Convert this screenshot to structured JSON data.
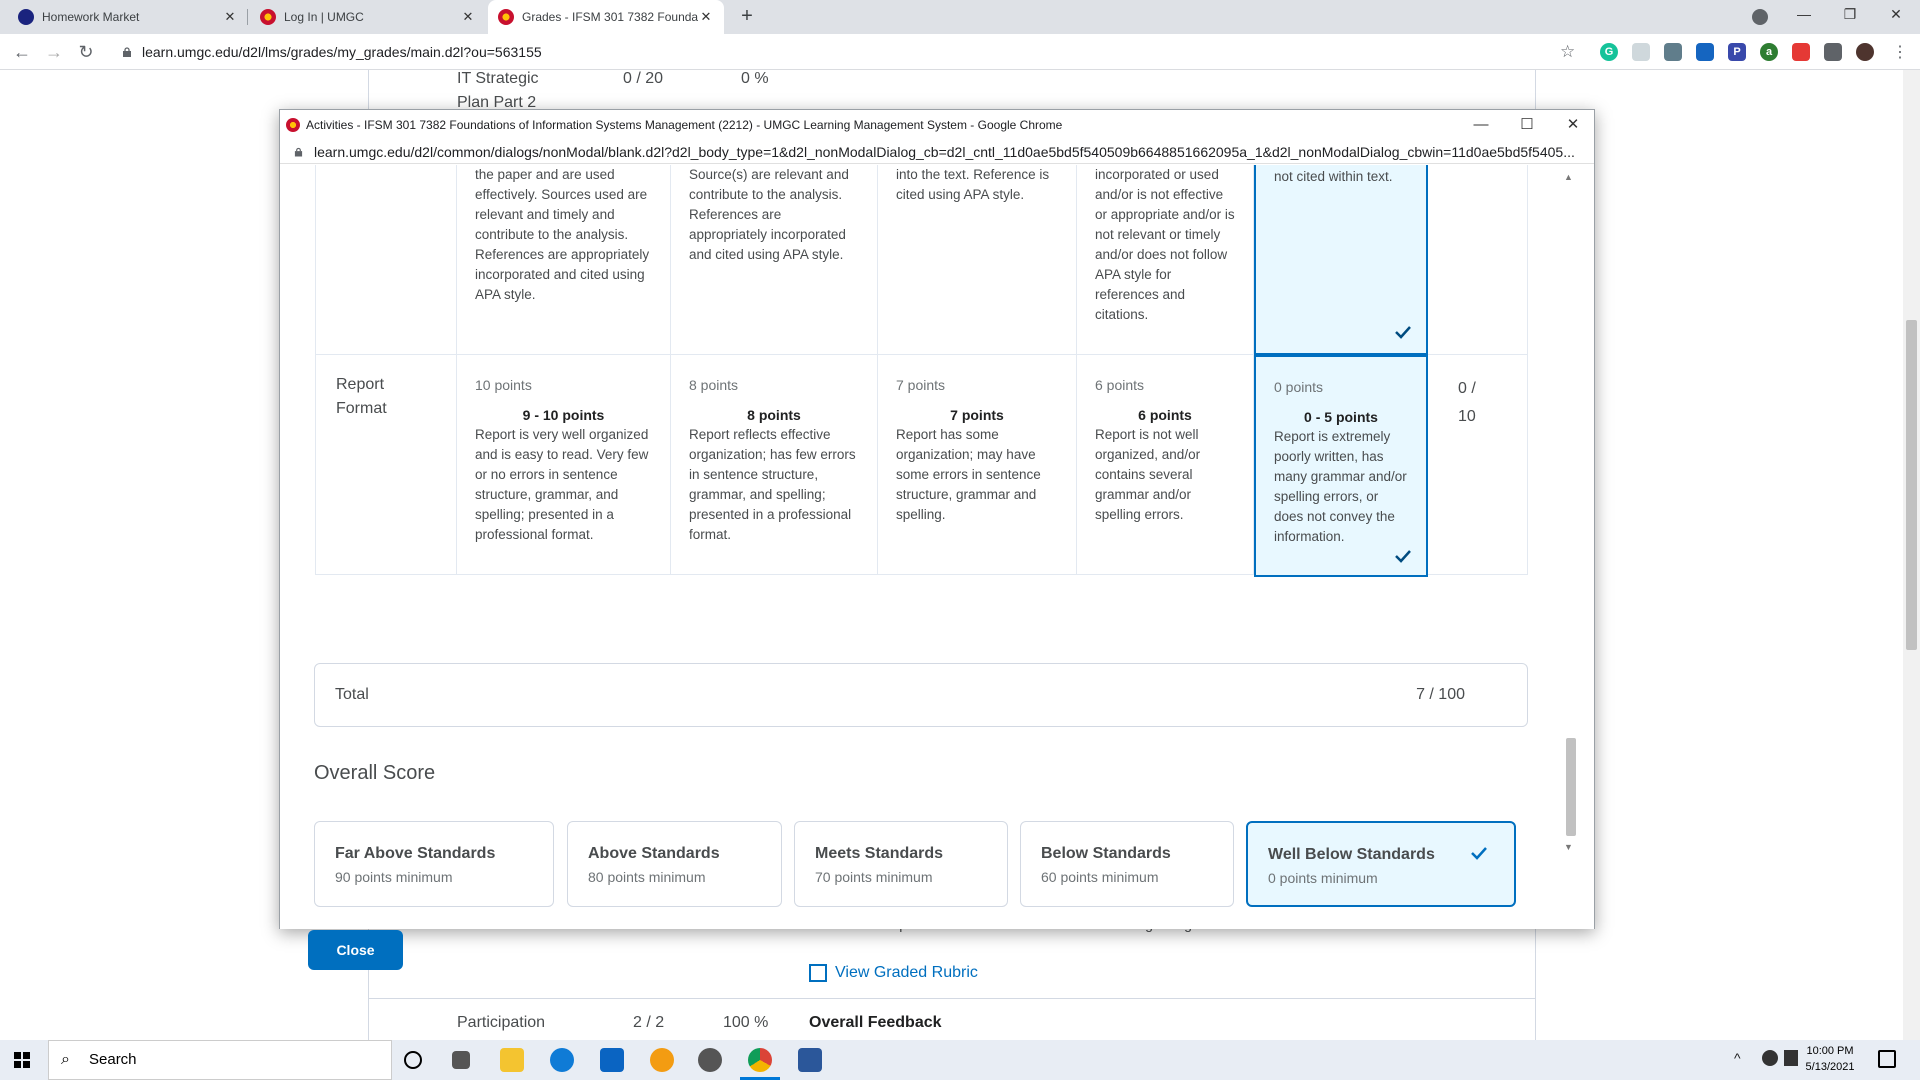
{
  "browser": {
    "tabs": [
      {
        "title": "Homework Market"
      },
      {
        "title": "Log In | UMGC"
      },
      {
        "title": "Grades - IFSM 301 7382 Foundat"
      }
    ],
    "url": "learn.umgc.edu/d2l/lms/grades/my_grades/main.d2l?ou=563155"
  },
  "background_page": {
    "row1": {
      "name": "IT Strategic",
      "name2": "Plan Part 2",
      "score": "0 / 20",
      "pct": "0 %"
    },
    "partial_text": "to at least two posts to meet or exceed the discussion grading standard.",
    "view_rubric": "View Graded Rubric",
    "row2": {
      "name": "Participation",
      "score": "2 / 2",
      "pct": "100 %",
      "feedback": "Overall Feedback"
    }
  },
  "popup": {
    "window_title": "Activities - IFSM 301 7382 Foundations of Information Systems Management (2212) - UMGC Learning Management System - Google Chrome",
    "url": "learn.umgc.edu/d2l/common/dialogs/nonModal/blank.d2l?d2l_body_type=1&d2l_nonModalDialog_cb=d2l_cntl_11d0ae5bd5f540509b6648851662095a_1&d2l_nonModalDialog_cbwin=11d0ae5bd5f5405...",
    "top_row": [
      "the paper and are used effectively. Sources used are relevant and timely and contribute to the analysis. References are appropriately incorporated and cited using APA style.",
      "Source(s) are relevant and contribute to the analysis. References are appropriately incorporated and cited using APA style.",
      "into the text. Reference is cited using APA style.",
      "incorporated or used and/or is not effective or appropriate and/or is not relevant or timely and/or does not follow APA style for references and citations.",
      "not cited within text."
    ],
    "report_format": {
      "criterion": "Report Format",
      "score_num": "0 /",
      "score_den": "10",
      "levels": [
        {
          "points": "10 points",
          "range": "9 - 10 points",
          "desc": "Report is very well organized and is easy to read.  Very few or no errors in sentence structure, grammar, and spelling; presented in a professional format."
        },
        {
          "points": "8 points",
          "range": "8 points",
          "desc": "Report reflects effective organization; has few errors in sentence structure, grammar, and spelling; presented in a professional format."
        },
        {
          "points": "7 points",
          "range": "7 points",
          "desc": "Report has some organization; may have some errors in sentence structure, grammar and spelling."
        },
        {
          "points": "6 points",
          "range": "6 points",
          "desc": "Report is not well organized, and/or contains several grammar and/or spelling errors."
        },
        {
          "points": "0 points",
          "range": "0 - 5 points",
          "desc": "Report is extremely poorly written, has many grammar and/or spelling errors, or does not convey the information."
        }
      ]
    },
    "total": {
      "label": "Total",
      "value": "7 / 100"
    },
    "overall_title": "Overall Score",
    "overall_levels": [
      {
        "name": "Far Above Standards",
        "min": "90 points minimum"
      },
      {
        "name": "Above Standards",
        "min": "80 points minimum"
      },
      {
        "name": "Meets Standards",
        "min": "70 points minimum"
      },
      {
        "name": "Below Standards",
        "min": "60 points minimum"
      },
      {
        "name": "Well Below Standards",
        "min": "0 points minimum"
      }
    ],
    "close_label": "Close"
  },
  "taskbar": {
    "search": "Search",
    "time": "10:00 PM",
    "date": "5/13/2021"
  },
  "colors": {
    "accent": "#006fbf",
    "selected_bg": "#e8f8ff"
  }
}
